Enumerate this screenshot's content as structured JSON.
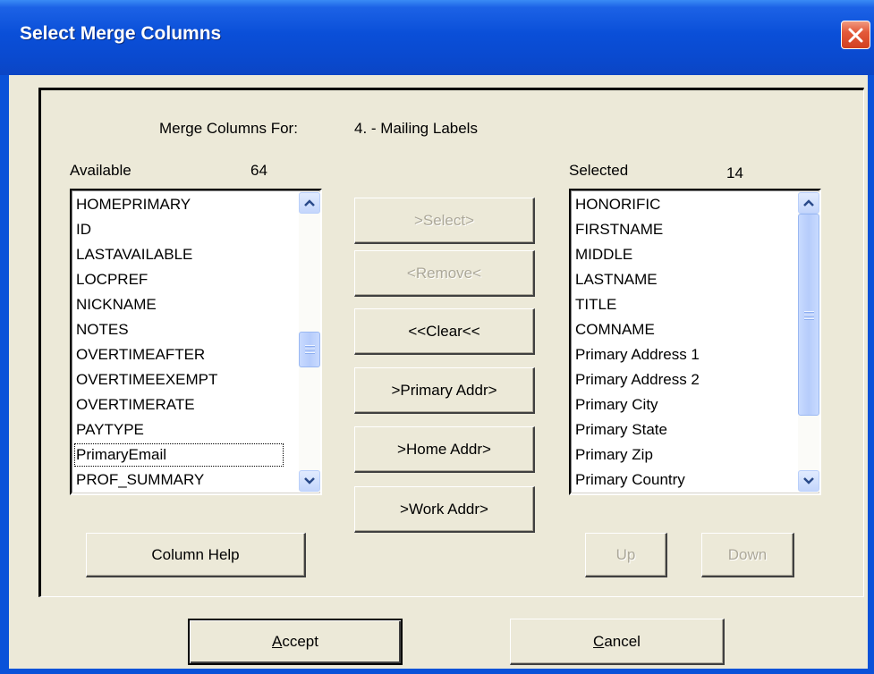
{
  "window": {
    "title": "Select Merge Columns",
    "close_glyph": "close-icon"
  },
  "header": {
    "prefix": "Merge Columns For:",
    "value": "4. - Mailing Labels"
  },
  "available": {
    "label": "Available",
    "count": "64",
    "items": [
      "HOMEPRIMARY",
      "ID",
      "LASTAVAILABLE",
      "LOCPREF",
      "NICKNAME",
      "NOTES",
      "OVERTIMEAFTER",
      "OVERTIMEEXEMPT",
      "OVERTIMERATE",
      "PAYTYPE",
      "PrimaryEmail",
      "PROF_SUMMARY"
    ],
    "focused_index": 10
  },
  "selected": {
    "label": "Selected",
    "count": "14",
    "items": [
      "HONORIFIC",
      "FIRSTNAME",
      "MIDDLE",
      "LASTNAME",
      "TITLE",
      "COMNAME",
      "Primary Address 1",
      "Primary Address 2",
      "Primary City",
      "Primary State",
      "Primary Zip",
      "Primary Country"
    ]
  },
  "buttons": {
    "select": ">Select>",
    "remove": "<Remove<",
    "clear": "<<Clear<<",
    "primary_addr": ">Primary Addr>",
    "home_addr": ">Home Addr>",
    "work_addr": ">Work Addr>",
    "column_help": "Column Help",
    "up": "Up",
    "down": "Down",
    "accept_first": "A",
    "accept_rest": "ccept",
    "cancel_first": "C",
    "cancel_rest": "ancel"
  },
  "colors": {
    "titlebar": "#0a4fd8",
    "face": "#ece9d8",
    "disabled_text": "#aca899"
  }
}
